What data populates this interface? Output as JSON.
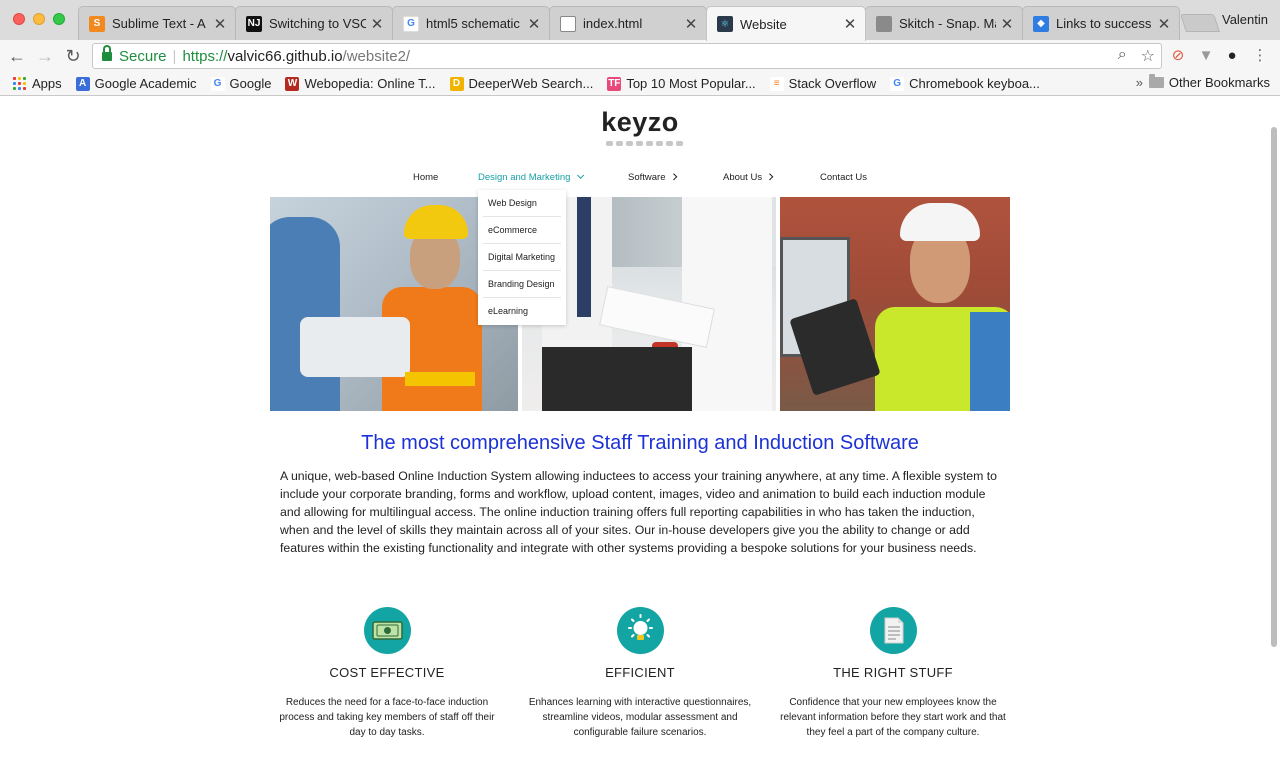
{
  "browser": {
    "tabs": [
      {
        "title": "Sublime Text - A s",
        "icon": "sublime-icon",
        "color": "#f2891e"
      },
      {
        "title": "Switching to VSCo",
        "icon": "nj-icon",
        "color": "#111111"
      },
      {
        "title": "html5 schematic -",
        "icon": "google-icon",
        "color": "#4285f4"
      },
      {
        "title": "index.html",
        "icon": "file-icon",
        "color": "#777777"
      },
      {
        "title": "Website",
        "icon": "react-icon",
        "color": "#2a3a4a"
      },
      {
        "title": "Skitch - Snap. Ma",
        "icon": "apple-icon",
        "color": "#8a8a8a"
      },
      {
        "title": "Links to success -",
        "icon": "layers-icon",
        "color": "#2f7de1"
      }
    ],
    "profile_name": "Valentin",
    "omnibox": {
      "secure_label": "Secure",
      "url_scheme": "https://",
      "url_host": "valvic66.github.io",
      "url_path": "/website2/"
    },
    "bookmarks": [
      {
        "label": "Apps",
        "icon": "apps-icon"
      },
      {
        "label": "Google Academic",
        "icon": "google-academic-icon",
        "color": "#3b6ed8"
      },
      {
        "label": "Google",
        "icon": "google-icon",
        "color": "#4285f4"
      },
      {
        "label": "Webopedia: Online T...",
        "icon": "webopedia-icon",
        "color": "#b42a1e"
      },
      {
        "label": "DeeperWeb Search...",
        "icon": "deeperweb-icon",
        "color": "#f0b400"
      },
      {
        "label": "Top 10 Most Popular...",
        "icon": "tf-icon",
        "color": "#e8487a"
      },
      {
        "label": "Stack Overflow",
        "icon": "stackoverflow-icon",
        "color": "#f48024"
      },
      {
        "label": "Chromebook keyboa...",
        "icon": "google-icon",
        "color": "#4285f4"
      }
    ],
    "other_bookmarks": "Other Bookmarks"
  },
  "site": {
    "logo": "keyzo",
    "nav": [
      {
        "label": "Home"
      },
      {
        "label": "Design and Marketing"
      },
      {
        "label": "Software"
      },
      {
        "label": "About Us"
      },
      {
        "label": "Contact Us"
      }
    ],
    "dropdown": [
      "Web Design",
      "eCommerce",
      "Digital Marketing",
      "Branding Design",
      "eLearning"
    ],
    "headline": "The most comprehensive Staff Training and Induction Software",
    "body": "A unique, web-based Online Induction System allowing inductees to access your training anywhere, at any time. A flexible system to include your corporate branding, forms and workflow, upload content, images, video and animation to build each induction module and allowing for multilingual access. The online induction training offers full reporting capabilities in who has taken the induction, when and the level of skills they maintain across all of your sites. Our in-house developers give you the ability to change or add features within the existing functionality and integrate with other systems providing a bespoke solutions for your business needs.",
    "features": [
      {
        "title": "COST EFFECTIVE",
        "icon": "money-icon",
        "desc": "Reduces the need for a face-to-face induction process and taking key members of staff off their day to day tasks."
      },
      {
        "title": "EFFICIENT",
        "icon": "lightbulb-icon",
        "desc": "Enhances learning with interactive questionnaires, streamline videos, modular assessment and configurable failure scenarios."
      },
      {
        "title": "THE RIGHT STUFF",
        "icon": "document-icon",
        "desc": "Confidence that your new employees know the relevant information before they start work and that they feel a part of the company culture."
      }
    ],
    "colors": {
      "accent": "#12a5a3",
      "headline": "#1c31d6",
      "nav_active": "#17a1a5"
    }
  }
}
